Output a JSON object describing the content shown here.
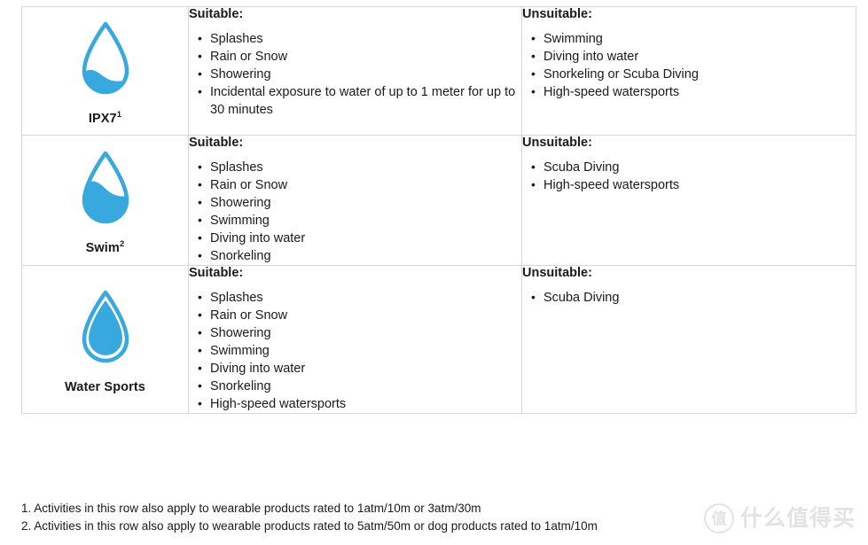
{
  "theme": {
    "droplet_blue": "#38A9DF",
    "border_gray": "#D6D6D6",
    "text_color": "#1A1A1A",
    "watermark_gray": "#E3E3E3"
  },
  "table": {
    "rows": [
      {
        "icon_name": "water-droplet-partial-fill-icon",
        "fill_level": "one-third",
        "label": "IPX7",
        "label_sup": "1",
        "suitable": {
          "heading": "Suitable:",
          "items": [
            "Splashes",
            "Rain or Snow",
            "Showering",
            "Incidental exposure to water of up to 1 meter for up to 30 minutes"
          ]
        },
        "unsuitable": {
          "heading": "Unsuitable:",
          "items": [
            "Swimming",
            "Diving into water",
            "Snorkeling or Scuba Diving",
            "High-speed watersports"
          ]
        }
      },
      {
        "icon_name": "water-droplet-two-thirds-fill-icon",
        "fill_level": "two-thirds",
        "label": "Swim",
        "label_sup": "2",
        "suitable": {
          "heading": "Suitable:",
          "items": [
            "Splashes",
            "Rain or Snow",
            "Showering",
            "Swimming",
            "Diving into water",
            "Snorkeling"
          ]
        },
        "unsuitable": {
          "heading": "Unsuitable:",
          "items": [
            "Scuba Diving",
            "High-speed watersports"
          ]
        }
      },
      {
        "icon_name": "water-droplet-full-fill-icon",
        "fill_level": "full",
        "label": "Water Sports",
        "label_sup": "",
        "suitable": {
          "heading": "Suitable:",
          "items": [
            "Splashes",
            "Rain or Snow",
            "Showering",
            "Swimming",
            "Diving into water",
            "Snorkeling",
            "High-speed watersports"
          ]
        },
        "unsuitable": {
          "heading": "Unsuitable:",
          "items": [
            "Scuba Diving"
          ]
        }
      }
    ]
  },
  "footnotes": [
    "1. Activities in this row also apply to wearable products rated to 1atm/10m or 3atm/30m",
    "2. Activities in this row also apply to wearable products rated to 5atm/50m or dog products rated to 1atm/10m"
  ],
  "watermark": {
    "badge": "值",
    "text": "什么值得买"
  }
}
